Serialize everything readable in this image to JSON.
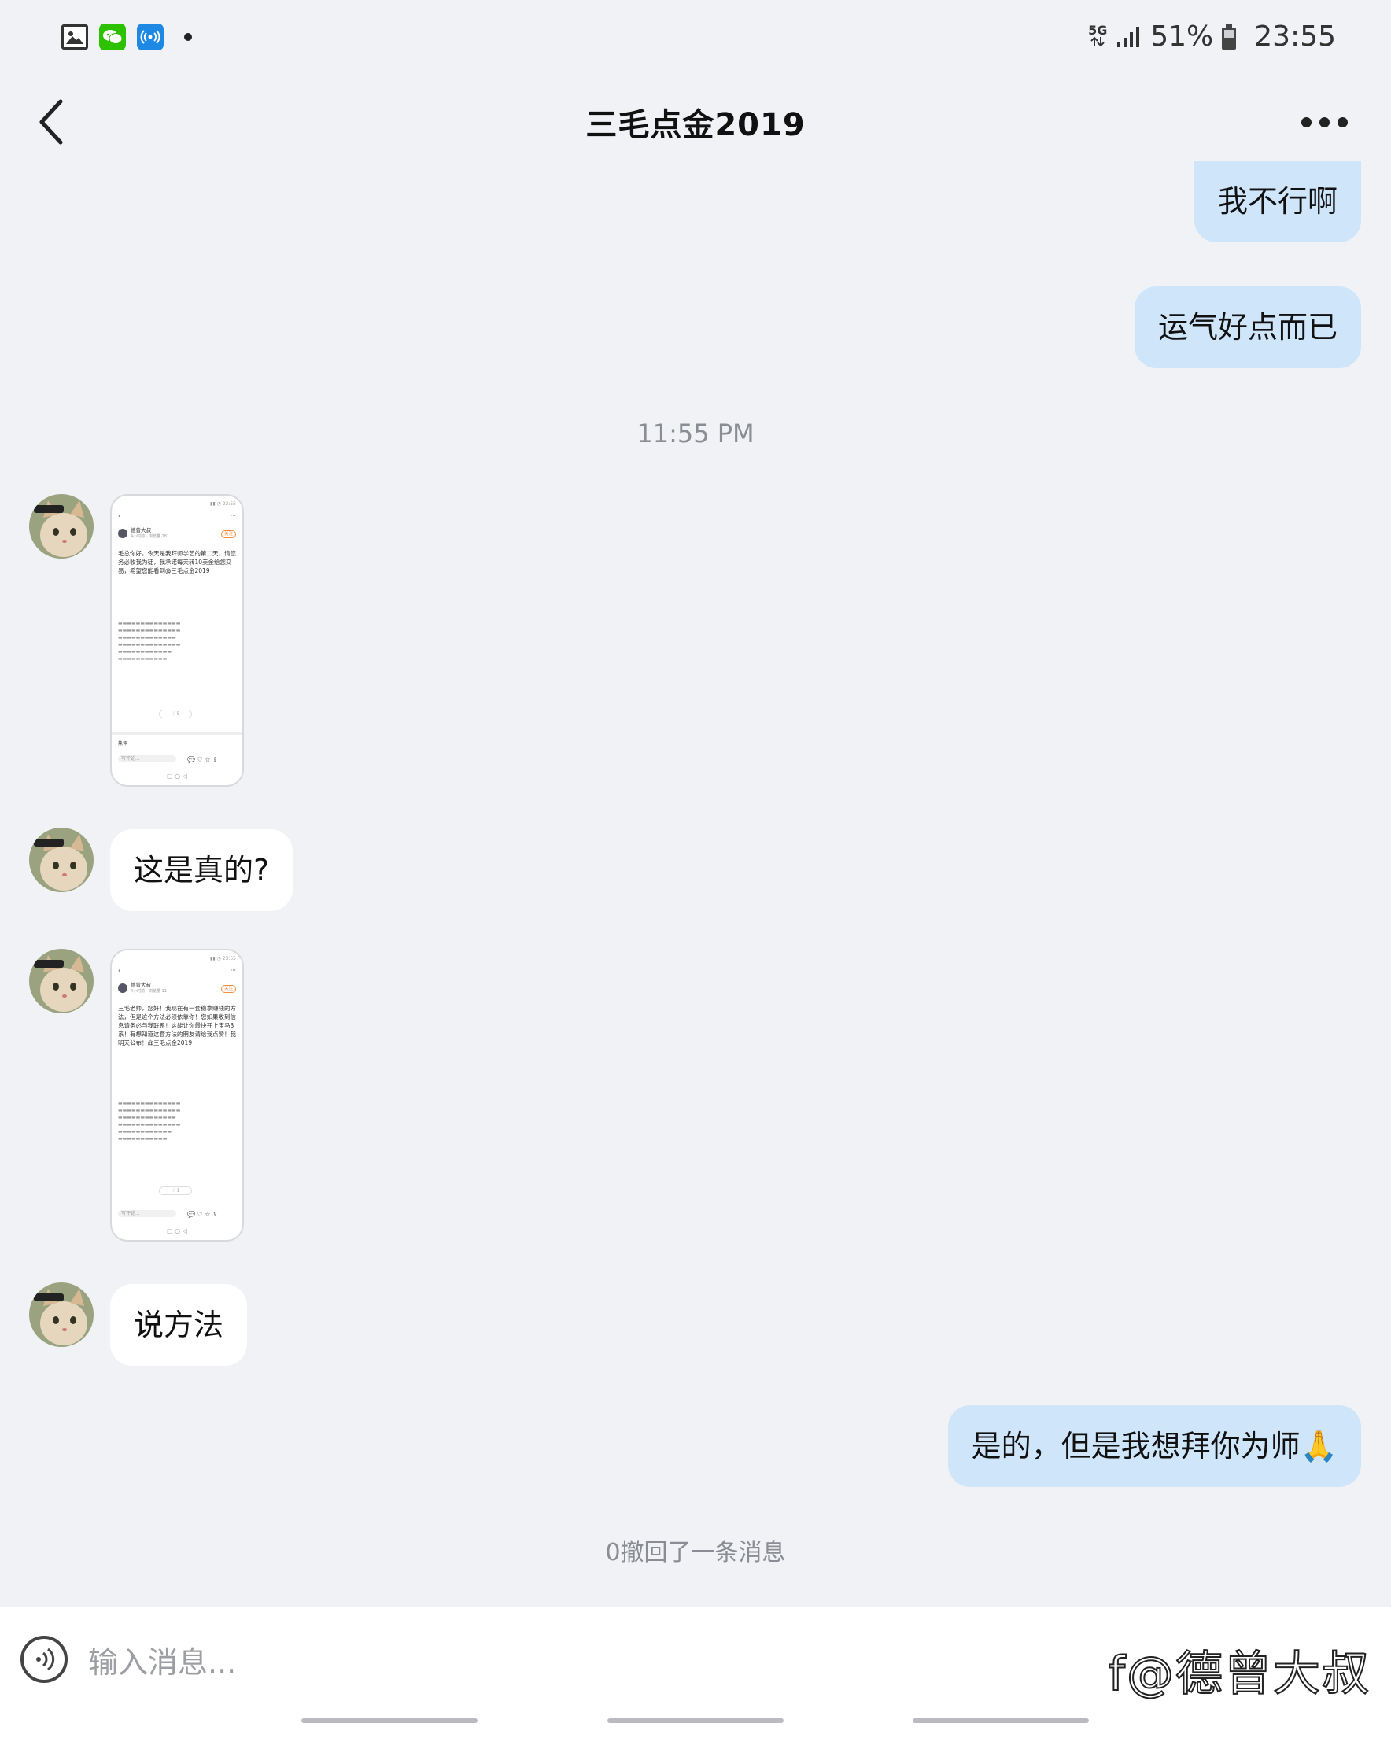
{
  "status_bar": {
    "network": "5G",
    "battery": "51%",
    "time": "23:55",
    "icons": [
      "gallery-icon",
      "wechat-icon",
      "hotspot-icon",
      "notification-dot"
    ]
  },
  "header": {
    "title": "三毛点金2019",
    "back_icon": "chevron-left-icon",
    "more_icon": "more-icon"
  },
  "messages": {
    "out_1": "我不行啊",
    "out_2": "运气好点而已",
    "timestamp": "11:55 PM",
    "screenshot_1": {
      "author": "德曾大叔",
      "meta": "4小时前 · 浏览量 181",
      "follow": "关注",
      "body": "毛总你好，今天是我拜师学艺的第二天，请您务必收我为徒，我承诺每天转10美金给您交易，希望您能看到@三毛点金2019",
      "like": "5",
      "hot": "热评",
      "comment_ph": "写评论..."
    },
    "in_1": "这是真的?",
    "screenshot_2": {
      "author": "德曾大叔",
      "meta": "4小时前 · 浏览量 11",
      "follow": "关注",
      "body": "三毛老师，您好！我现在有一套稳拿赚钱的方法，但是这个方法必须依靠你！您如果收到信息请务必与我联系！这能让你最快开上宝马3系！有想知道这套方法的朋友请给我点赞！我明天公布！@三毛点金2019",
      "like": "1",
      "comment_ph": "写评论..."
    },
    "in_2": "说方法",
    "out_3": "是的，但是我想拜你为师🙏",
    "recalled": "0撤回了一条消息"
  },
  "input": {
    "placeholder": "输入消息...",
    "voice_icon": "voice-icon"
  },
  "watermark": "f@德曾大叔",
  "colors": {
    "background": "#f1f2f5",
    "outgoing_bubble": "#cfe5fa",
    "incoming_bubble": "#ffffff",
    "timestamp_text": "#8a8d93"
  }
}
